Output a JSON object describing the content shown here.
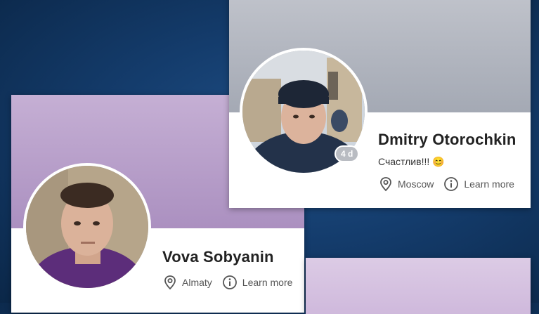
{
  "cards": [
    {
      "name": "Vova Sobyanin",
      "location": "Almaty",
      "learn_more": "Learn more"
    },
    {
      "name": "Dmitry Otorochkin",
      "status": "Счастлив!!! 😊",
      "badge": "4 d",
      "location": "Moscow",
      "learn_more": "Learn more"
    }
  ],
  "colors": {
    "background": "#143c6c",
    "cover_purple": "#b59cc6",
    "cover_gray": "#a8adb8",
    "cover_lilac": "#d8c8e0"
  },
  "icons": [
    "location-pin-icon",
    "info-icon"
  ]
}
